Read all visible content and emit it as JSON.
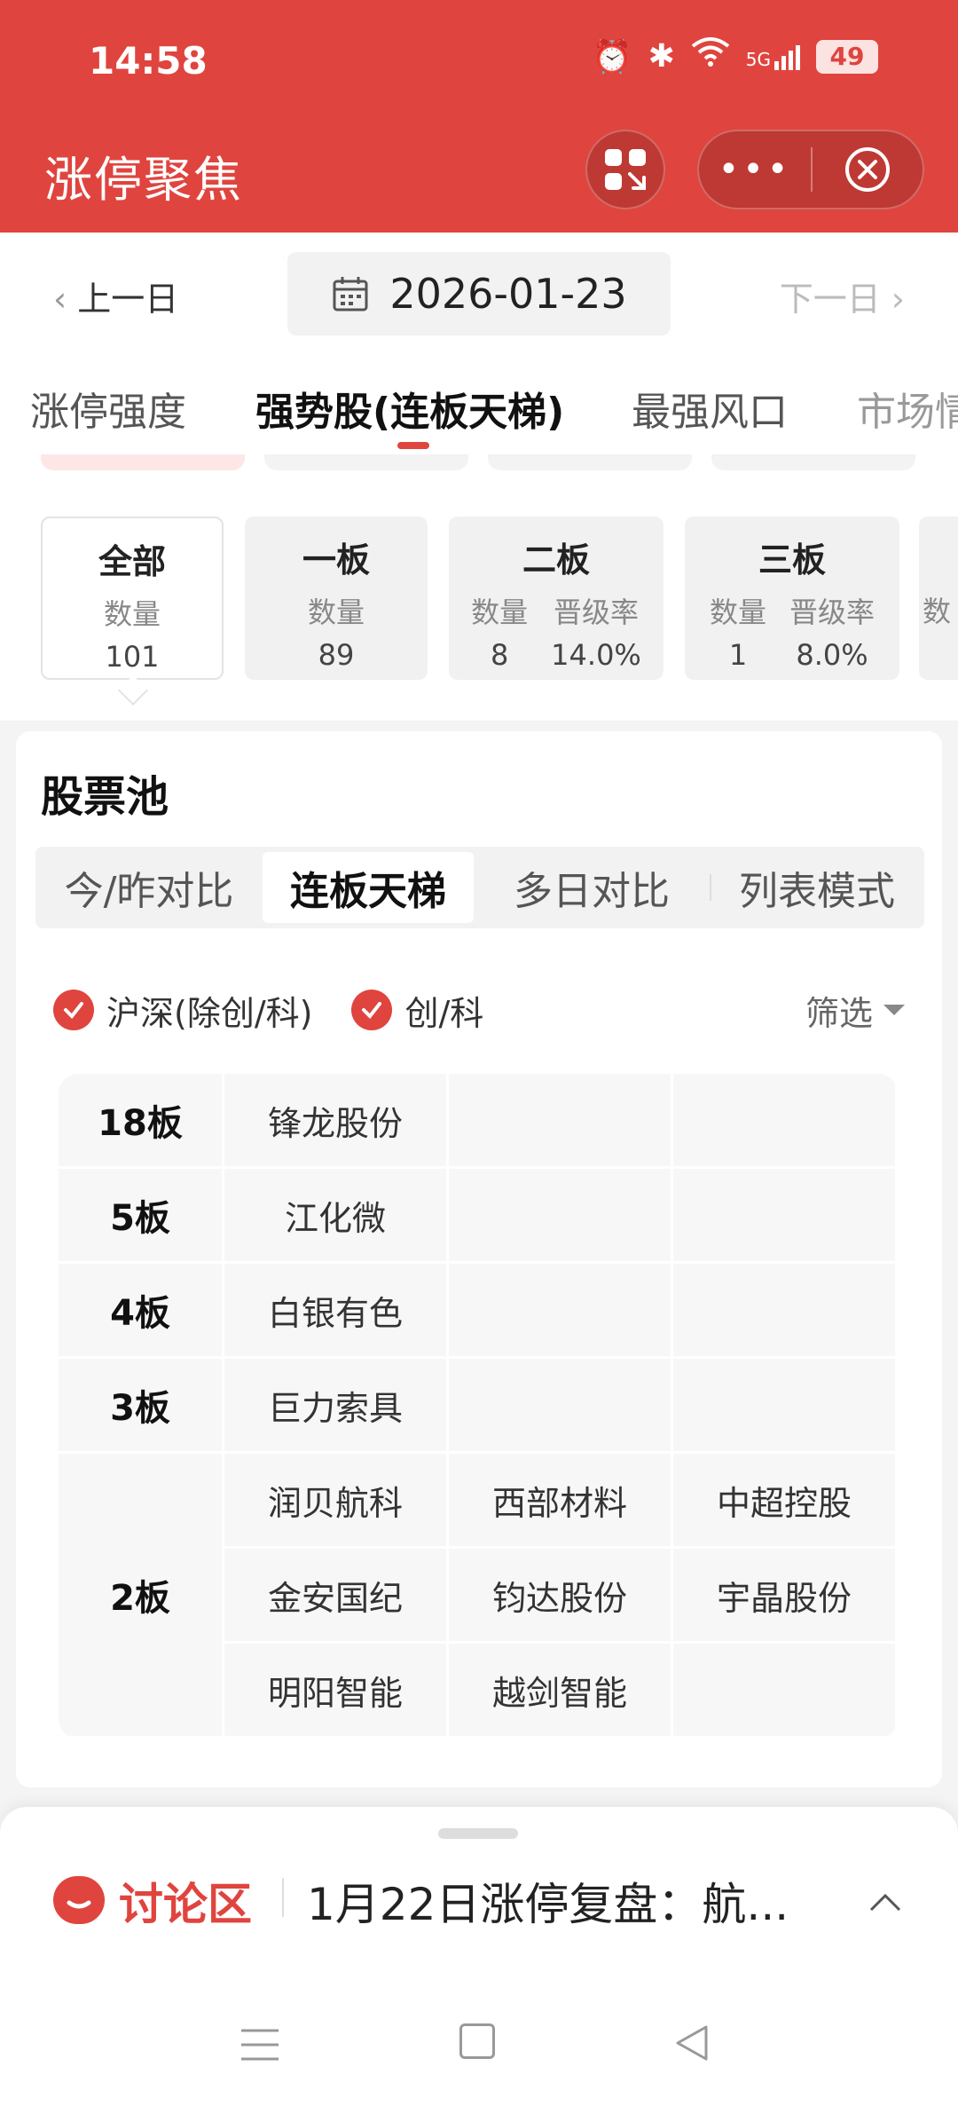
{
  "status": {
    "time": "14:58",
    "battery": "49",
    "network": "5G"
  },
  "header": {
    "title": "涨停聚焦"
  },
  "datebar": {
    "prev": "上一日",
    "date": "2026-01-23",
    "next": "下一日"
  },
  "main_tabs": [
    "涨停强度",
    "强势股(连板天梯)",
    "最强风口",
    "市场情"
  ],
  "board_cards": [
    {
      "name": "全部",
      "qty_label": "数量",
      "qty": "101"
    },
    {
      "name": "一板",
      "qty_label": "数量",
      "qty": "89"
    },
    {
      "name": "二板",
      "qty_label": "数量",
      "qty": "8",
      "rate_label": "晋级率",
      "rate": "14.0%"
    },
    {
      "name": "三板",
      "qty_label": "数量",
      "qty": "1",
      "rate_label": "晋级率",
      "rate": "8.0%"
    },
    {
      "qty_label": "数"
    }
  ],
  "pool": {
    "title": "股票池",
    "subtabs": [
      "今/昨对比",
      "连板天梯",
      "多日对比",
      "列表模式"
    ],
    "filters": {
      "hs_label": "沪深(除创/科)",
      "ck_label": "创/科",
      "filter_label": "筛选"
    },
    "ladder": [
      {
        "board": "18板",
        "stocks": [
          "锋龙股份",
          "",
          ""
        ]
      },
      {
        "board": "5板",
        "stocks": [
          "江化微",
          "",
          ""
        ]
      },
      {
        "board": "4板",
        "stocks": [
          "白银有色",
          "",
          ""
        ]
      },
      {
        "board": "3板",
        "stocks": [
          "巨力索具",
          "",
          ""
        ]
      }
    ],
    "ladder2": {
      "board": "2板",
      "rows": [
        [
          "润贝航科",
          "西部材料",
          "中超控股"
        ],
        [
          "金安国纪",
          "钧达股份",
          "宇晶股份"
        ],
        [
          "明阳智能",
          "越剑智能",
          ""
        ]
      ]
    }
  },
  "discussion": {
    "label": "讨论区",
    "text": "1月22日涨停复盘：航..."
  },
  "colors": {
    "accent": "#e0443e"
  }
}
